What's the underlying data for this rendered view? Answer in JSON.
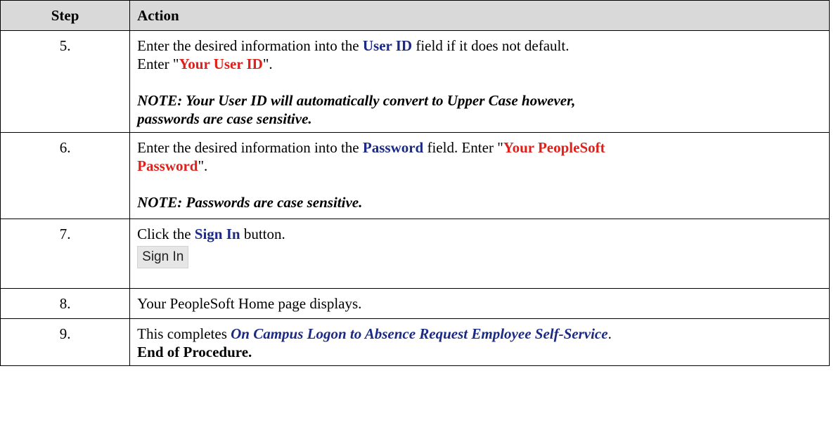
{
  "table": {
    "header": {
      "step": "Step",
      "action": "Action"
    },
    "rows": [
      {
        "step": "5.",
        "line1": {
          "prefix": "Enter the desired information into the ",
          "field": "User ID",
          "suffix": " field if it does not default."
        },
        "line2": {
          "prefix": "Enter \"",
          "value": "Your User ID",
          "suffix": "\"."
        },
        "note_line1": "NOTE: Your User ID will automatically convert to Upper Case however,",
        "note_line2": "passwords are case sensitive."
      },
      {
        "step": "6.",
        "line1": {
          "prefix": "Enter the desired information into the ",
          "field": "Password",
          "middle": " field. Enter \"",
          "value_part1": "Your PeopleSoft",
          "value_part2": "Password",
          "suffix": "\"."
        },
        "note": "NOTE: Passwords are case sensitive."
      },
      {
        "step": "7.",
        "line1": {
          "prefix": "Click the ",
          "button": "Sign In",
          "suffix": " button."
        },
        "button_image_label": "Sign In"
      },
      {
        "step": "8.",
        "text": "Your PeopleSoft Home page displays."
      },
      {
        "step": "9.",
        "line1": {
          "prefix": "This completes ",
          "procedure": "On Campus Logon to Absence Request Employee Self-Service",
          "suffix": "."
        },
        "end_text": "End of Procedure."
      }
    ]
  },
  "colors": {
    "header_bg": "#d9d9d9",
    "ui_term": "#1b2a84",
    "user_value": "#e0201b"
  }
}
